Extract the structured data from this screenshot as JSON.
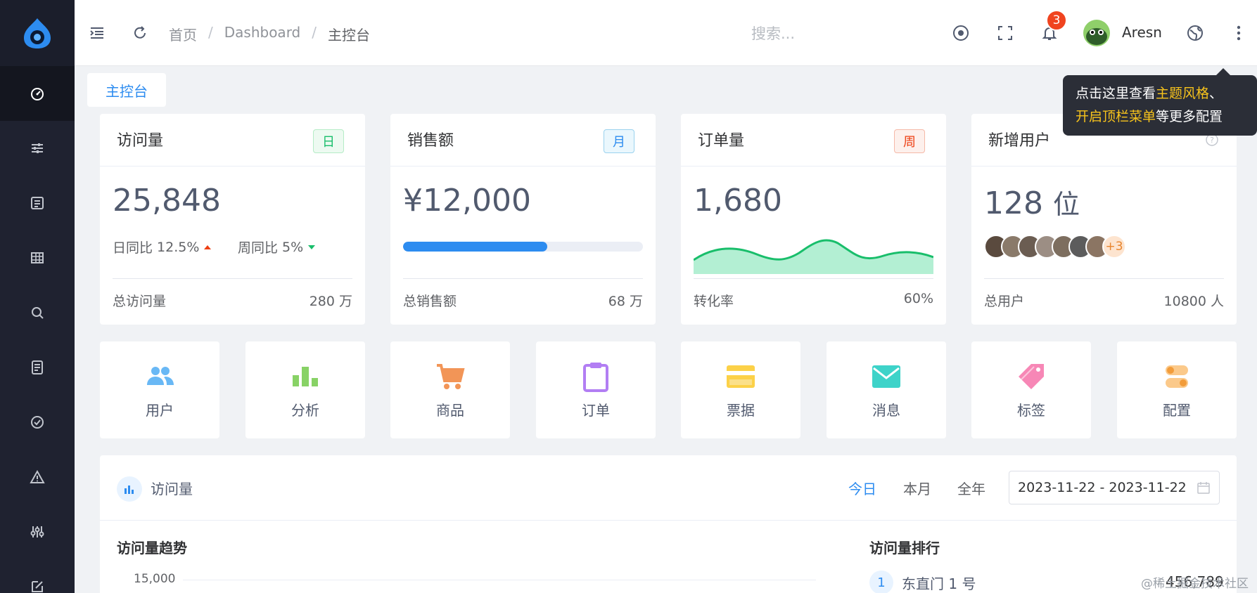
{
  "header": {
    "breadcrumb": [
      "首页",
      "Dashboard",
      "主控台"
    ],
    "search_placeholder": "搜索...",
    "notification_count": "3",
    "username": "Aresn"
  },
  "tab": {
    "label": "主控台"
  },
  "tooltip": {
    "part1": "点击这里查看",
    "hl1": "主题风格",
    "part2": "、",
    "hl2": "开启顶栏菜单",
    "part3": "等更多配置"
  },
  "cards": {
    "visits": {
      "title": "访问量",
      "tag": "日",
      "value": "25,848",
      "day_label": "日同比",
      "day_value": "12.5%",
      "week_label": "周同比",
      "week_value": "5%",
      "footer_label": "总访问量",
      "footer_value": "280 万"
    },
    "sales": {
      "title": "销售额",
      "tag": "月",
      "value": "¥12,000",
      "progress": 0.6,
      "footer_label": "总销售额",
      "footer_value": "68 万"
    },
    "orders": {
      "title": "订单量",
      "tag": "周",
      "value": "1,680",
      "footer_label": "转化率",
      "footer_value": "60%"
    },
    "users": {
      "title": "新增用户",
      "value": "128",
      "unit": "位",
      "more": "+3",
      "footer_label": "总用户",
      "footer_value": "10800 人"
    }
  },
  "tiles": [
    "用户",
    "分析",
    "商品",
    "订单",
    "票据",
    "消息",
    "标签",
    "配置"
  ],
  "panel": {
    "title": "访问量",
    "periods": [
      "今日",
      "本月",
      "全年"
    ],
    "date_range": "2023-11-22 - 2023-11-22",
    "trend_title": "访问量趋势",
    "y_tick": "15,000",
    "rank_title": "访问量排行",
    "rank": [
      {
        "no": "1",
        "name": "东直门 1 号",
        "value": "456,789"
      }
    ]
  },
  "watermark": "@稀土掘金技术社区"
}
